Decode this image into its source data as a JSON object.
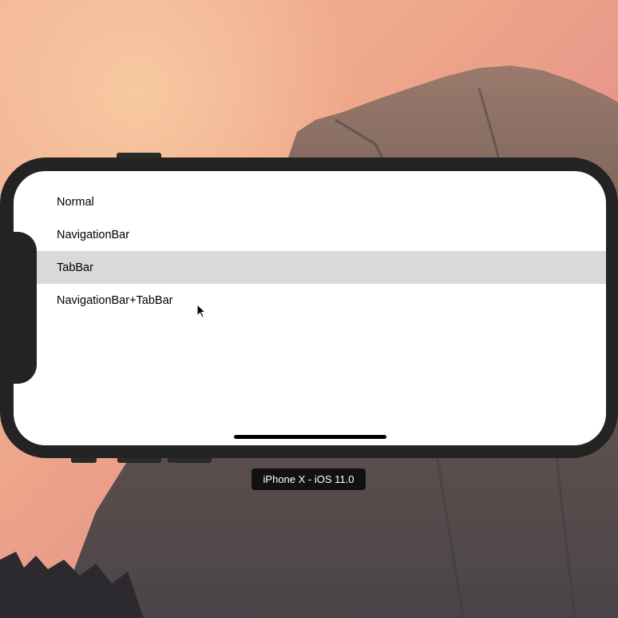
{
  "simulator": {
    "device_label": "iPhone X - iOS 11.0"
  },
  "table": {
    "rows": [
      {
        "label": "Normal"
      },
      {
        "label": "NavigationBar"
      },
      {
        "label": "TabBar",
        "selected": true
      },
      {
        "label": "NavigationBar+TabBar"
      }
    ]
  },
  "colors": {
    "selected_row": "#d9d9d9",
    "device_bezel": "#232323"
  },
  "icons": {
    "pointer": "cursor-arrow-icon"
  }
}
